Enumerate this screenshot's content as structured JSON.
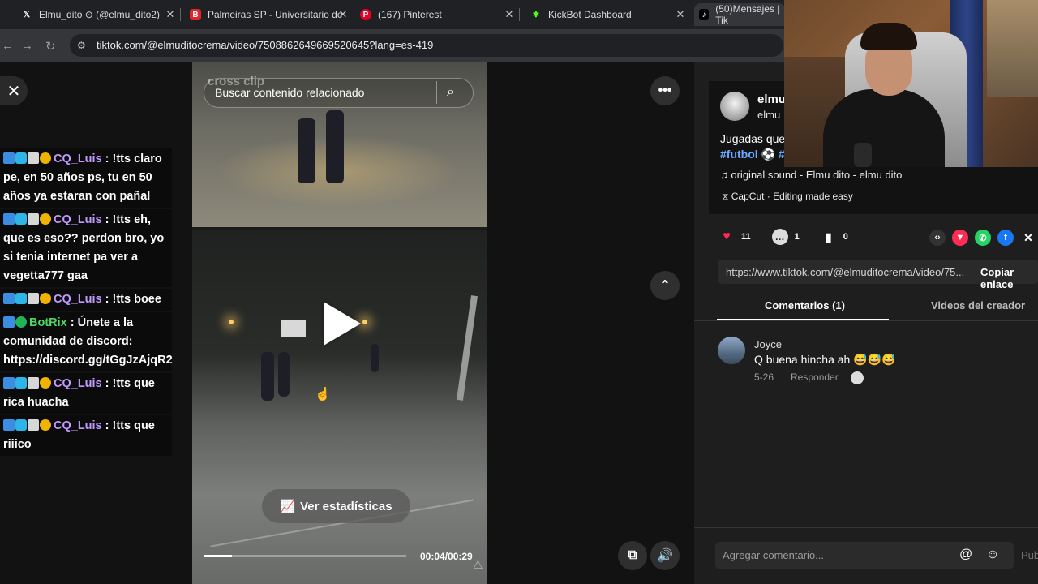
{
  "browser": {
    "tabs": [
      {
        "title": "Elmu_dito ⊙ (@elmu_dito2)",
        "icon": "x-icon",
        "active": false
      },
      {
        "title": "Palmeiras SP - Universitario de",
        "icon": "bolt-icon",
        "active": false
      },
      {
        "title": "(167) Pinterest",
        "icon": "pinterest-icon",
        "active": false
      },
      {
        "title": "KickBot Dashboard",
        "icon": "kickbot-icon",
        "active": false
      },
      {
        "title": "(50)Mensajes | Tik",
        "icon": "tiktok-icon",
        "active": true
      }
    ],
    "url": "tiktok.com/@elmuditocrema/video/7508862649669520645?lang=es-419"
  },
  "chat": {
    "messages": [
      {
        "user": "CQ_Luis",
        "text": ": !tts claro pe, en 50 años ps, tu en 50 años ya estaran con pañal",
        "color": "purple"
      },
      {
        "user": "CQ_Luis",
        "text": ": !tts eh, que es eso?? perdon bro, yo si tenia internet pa ver a vegetta777 gaa",
        "color": "purple"
      },
      {
        "user": "CQ_Luis",
        "text": ": !tts boee",
        "color": "purple"
      },
      {
        "user": "BotRix",
        "text": ": Únete a la comunidad de discord: https://discord.gg/tGgJzAjqR2",
        "color": "green"
      },
      {
        "user": "CQ_Luis",
        "text": ": !tts que rica huacha",
        "color": "purple"
      },
      {
        "user": "CQ_Luis",
        "text": ": !tts que riiico",
        "color": "purple"
      }
    ]
  },
  "video": {
    "watermark": "cross clip",
    "search_placeholder": "Buscar contenido relacionado",
    "stats_label": "Ver estadísticas",
    "time": "00:04/00:29",
    "progress": 0.14
  },
  "post": {
    "author": "elmu",
    "author_sub": "elmu",
    "desc": "Jugadas que",
    "hashtags": "#futbol ⚽ #",
    "music": "original sound - Elmu dito - elmu dito",
    "capcut": "CapCut · Editing made easy",
    "likes": "11",
    "comments": "1",
    "saves": "0",
    "link": "https://www.tiktok.com/@elmuditocrema/video/75...",
    "copy_label": "Copiar enlace",
    "tab_comments": "Comentarios (1)",
    "tab_videos": "Videos del creador"
  },
  "comment": {
    "name": "Joyce",
    "text": "Q buena hincha ah 😅😅😅",
    "date": "5-26",
    "reply": "Responder"
  },
  "composer": {
    "placeholder": "Agregar comentario...",
    "post": "Pub"
  },
  "colors": {
    "accent_purple": "#c29bff",
    "accent_green": "#4cd964",
    "heart": "#fe2c55",
    "link": "#6aa9ff"
  }
}
